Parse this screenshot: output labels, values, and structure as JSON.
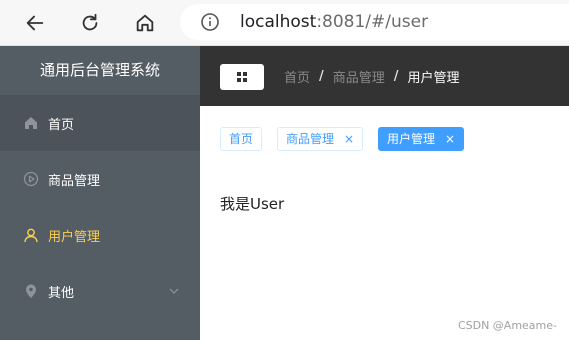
{
  "browser": {
    "url_host": "localhost",
    "url_rest": ":8081/#/user"
  },
  "sidebar": {
    "title": "通用后台管理系统",
    "items": [
      {
        "label": "首页",
        "icon": "home-icon"
      },
      {
        "label": "商品管理",
        "icon": "play-circle-icon"
      },
      {
        "label": "用户管理",
        "icon": "user-icon",
        "active": true
      },
      {
        "label": "其他",
        "icon": "location-icon",
        "has_submenu": true
      }
    ],
    "active_color": "#ffd04b",
    "background": "#545c64"
  },
  "header": {
    "breadcrumb": [
      "首页",
      "商品管理",
      "用户管理"
    ],
    "separator": "/"
  },
  "tags": [
    {
      "label": "首页",
      "closable": false
    },
    {
      "label": "商品管理",
      "closable": true
    },
    {
      "label": "用户管理",
      "closable": true,
      "active": true
    }
  ],
  "close_glyph": "×",
  "main": {
    "text": "我是User"
  },
  "watermark": "CSDN @Ameame-",
  "accent": "#409eff"
}
